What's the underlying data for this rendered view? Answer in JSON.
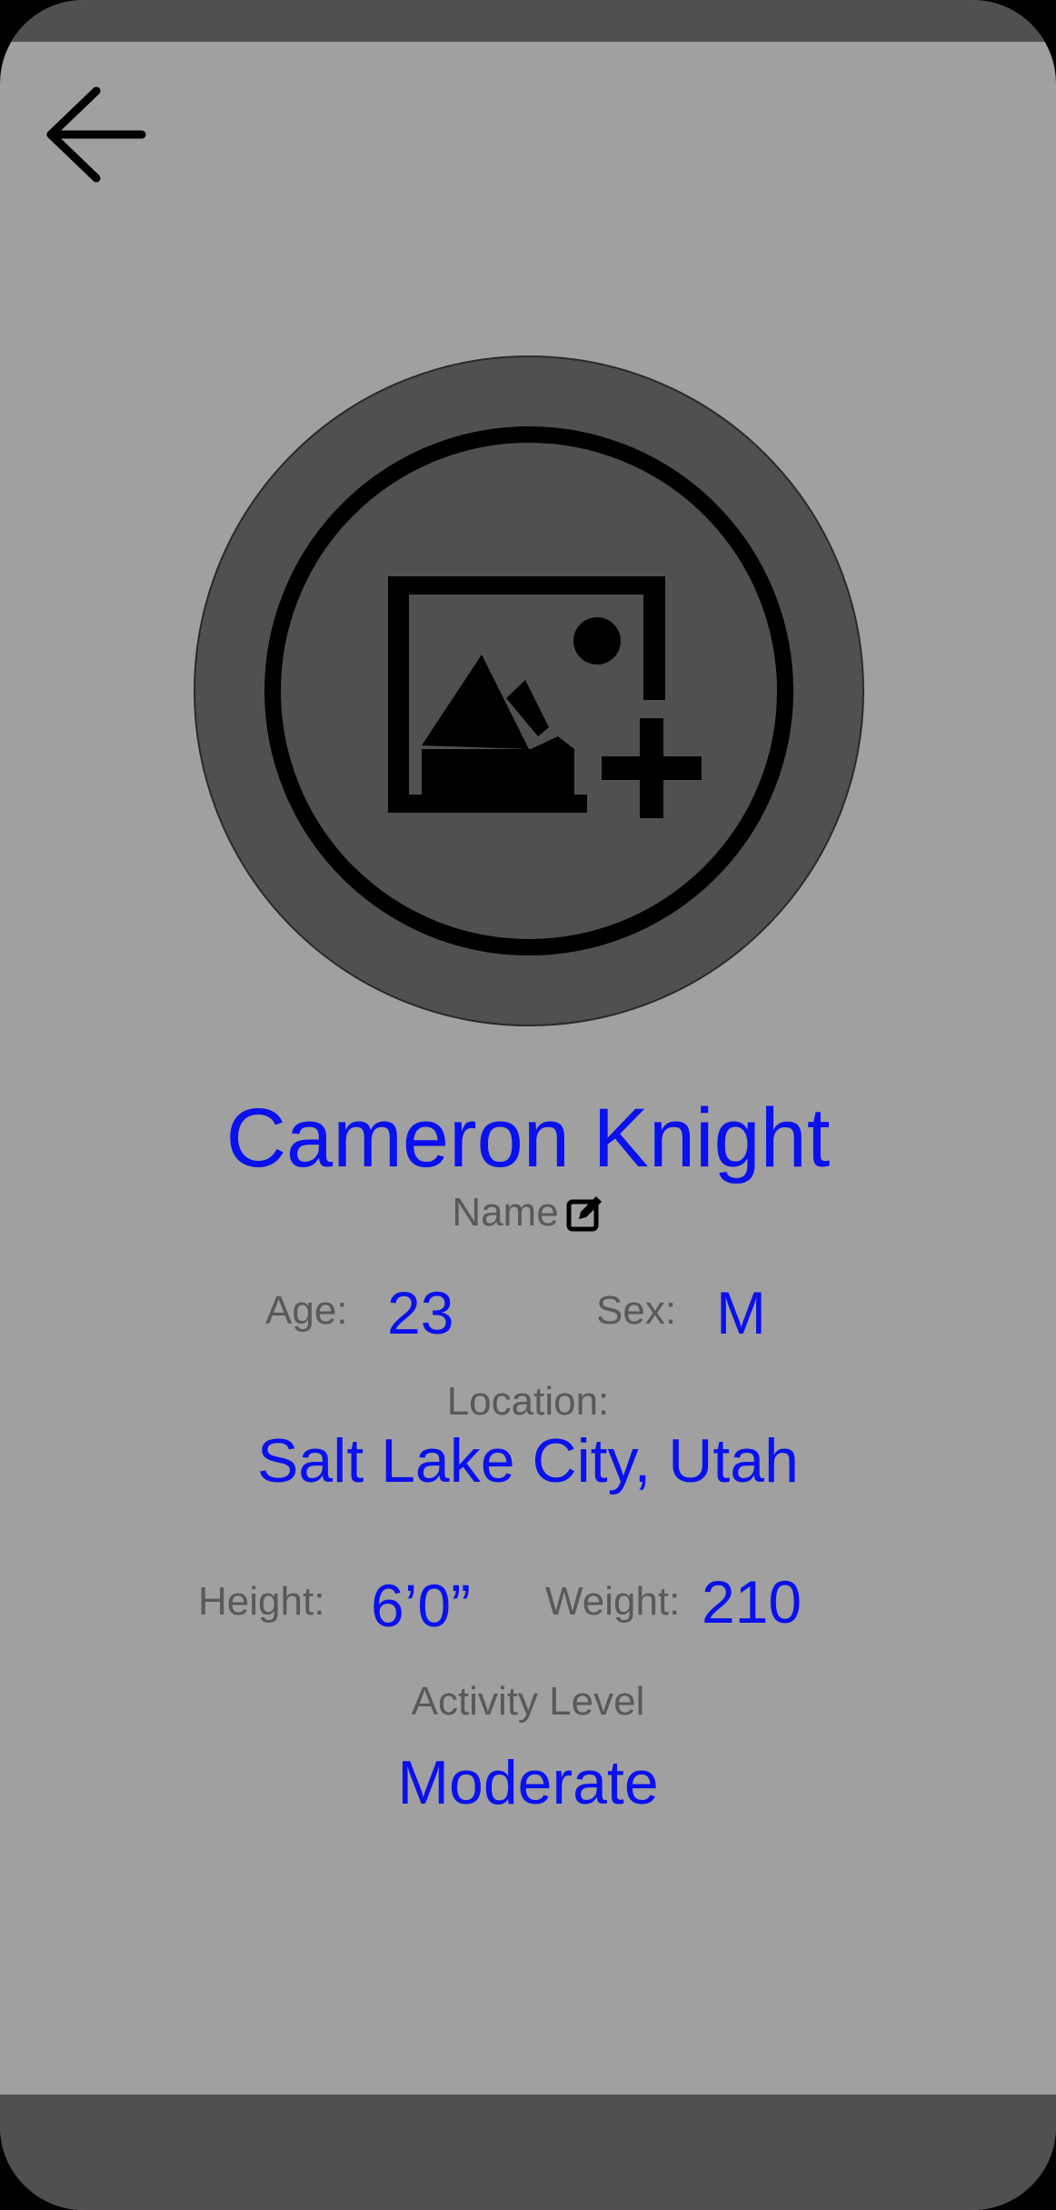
{
  "profile": {
    "name": "Cameron Knight",
    "name_label": "Name",
    "age_label": "Age:",
    "age": "23",
    "sex_label": "Sex:",
    "sex": "M",
    "location_label": "Location:",
    "location": "Salt Lake City, Utah",
    "height_label": "Height:",
    "height": "6’0”",
    "weight_label": "Weight:",
    "weight": "210",
    "activity_label": "Activity Level",
    "activity": "Moderate"
  },
  "icons": {
    "back": "arrow-left-icon",
    "avatar": "add-photo-icon",
    "edit": "edit-icon"
  },
  "colors": {
    "background": "#a0a0a0",
    "bars": "#505050",
    "value_text": "#0a10ee",
    "label_text": "#595959"
  }
}
